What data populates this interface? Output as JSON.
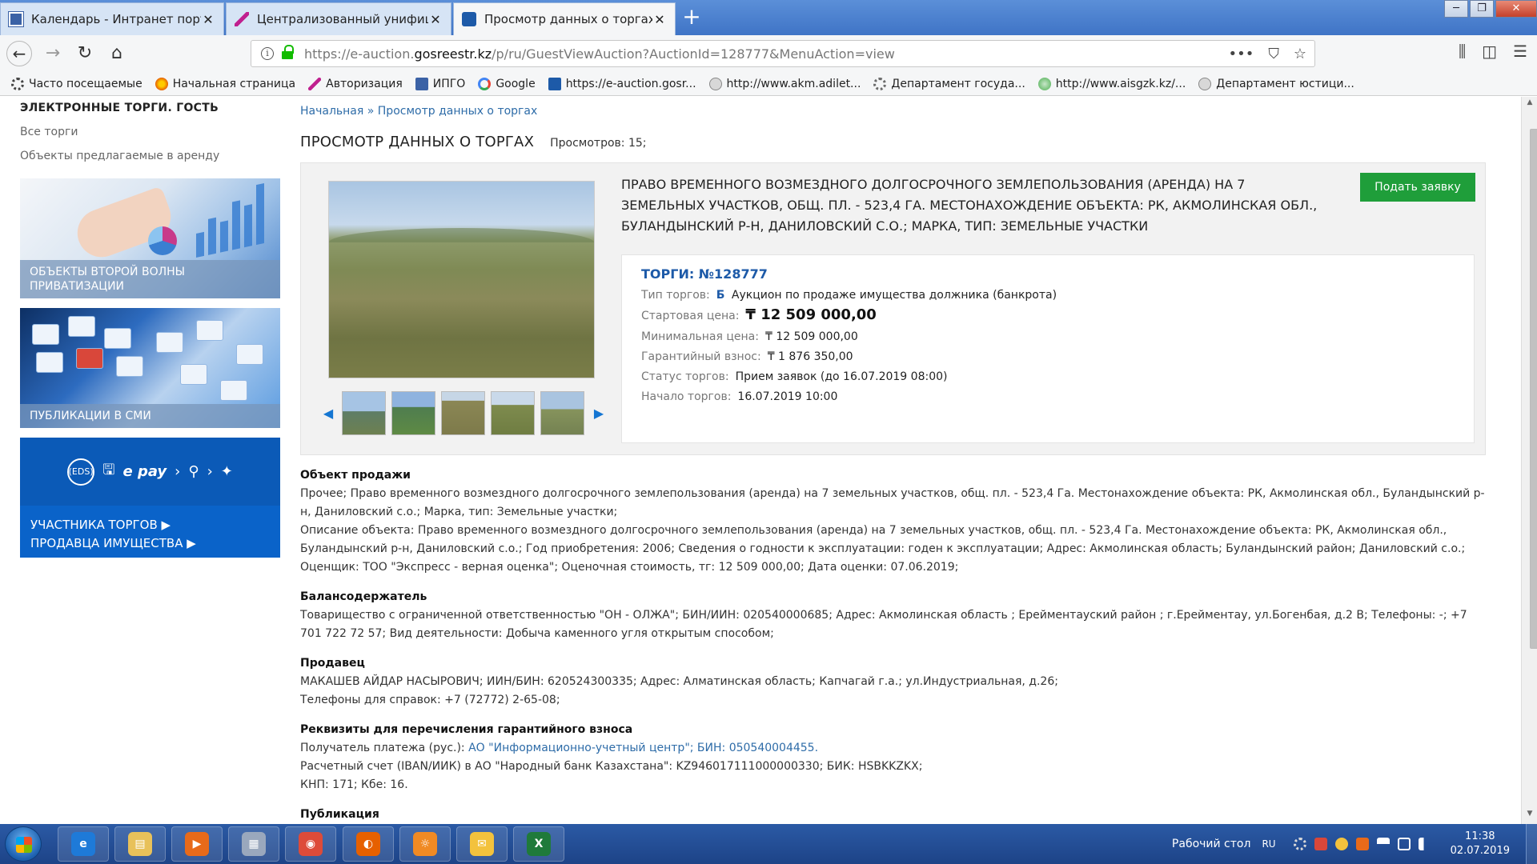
{
  "browser": {
    "tabs": [
      {
        "title": "Календарь - Интранет портал",
        "active": false,
        "color": "#3b62a6"
      },
      {
        "title": "Централизованный унифицированный",
        "active": false,
        "color": "#c0208f"
      },
      {
        "title": "Просмотр данных о торгах",
        "active": true,
        "color": "#1d5aa8"
      }
    ],
    "url_prefix": "https://e-auction.",
    "url_domain": "gosreestr.kz",
    "url_suffix": "/p/ru/GuestViewAuction?AuctionId=128777&MenuAction=view",
    "bookmarks": [
      {
        "label": "Часто посещаемые",
        "color": "#555555"
      },
      {
        "label": "Начальная страница",
        "color": "#e66000"
      },
      {
        "label": "Авторизация",
        "color": "#c0208f"
      },
      {
        "label": "ИПГО",
        "color": "#3b62a6"
      },
      {
        "label": "Google",
        "color": "#4285f4"
      },
      {
        "label": "https://e-auction.gosr...",
        "color": "#1d5aa8"
      },
      {
        "label": "http://www.akm.adilet...",
        "color": "#8a8a8a"
      },
      {
        "label": "Департамент госуда...",
        "color": "#6b6b6b"
      },
      {
        "label": "http://www.aisgzk.kz/...",
        "color": "#4caf50"
      },
      {
        "label": "Департамент юстици...",
        "color": "#8a8a8a"
      }
    ]
  },
  "sidebar": {
    "title": "ЭЛЕКТРОННЫЕ ТОРГИ. ГОСТЬ",
    "links": [
      "Все торги",
      "Объекты предлагаемые в аренду"
    ],
    "banner1_caption": "ОБЪЕКТЫ ВТОРОЙ ВОЛНЫ ПРИВАТИЗАЦИИ",
    "banner2_caption": "ПУБЛИКАЦИИ В СМИ",
    "banner3": {
      "eds": "(EDS)",
      "epay": "e pay",
      "link1": "УЧАСТНИКА ТОРГОВ ▶",
      "link2": "ПРОДАВЦА ИМУЩЕСТВА ▶"
    }
  },
  "breadcrumb": "Начальная » Просмотр данных о торгах",
  "heading": {
    "title": "ПРОСМОТР ДАННЫХ О ТОРГАХ",
    "views": "Просмотров: 15;"
  },
  "lot": {
    "title": "ПРАВО ВРЕМЕННОГО ВОЗМЕЗДНОГО ДОЛГОСРОЧНОГО ЗЕМЛЕПОЛЬЗОВАНИЯ (АРЕНДА) НА 7 ЗЕМЕЛЬНЫХ УЧАСТКОВ, ОБЩ. ПЛ. - 523,4 ГА. МЕСТОНАХОЖДЕНИЕ ОБЪЕКТА: РК, АКМОЛИНСКАЯ ОБЛ., БУЛАНДЫНСКИЙ Р-Н, ДАНИЛОВСКИЙ С.О.; МАРКА, ТИП: ЗЕМЕЛЬНЫЕ УЧАСТКИ",
    "apply_label": "Подать заявку",
    "auction_no": "ТОРГИ: №128777",
    "rows": {
      "type_label": "Тип торгов:",
      "type_code": "Б",
      "type_value": "Аукцион по продаже имущества должника (банкрота)",
      "start_price_label": "Стартовая цена:",
      "start_price_value": "₸ 12 509 000,00",
      "min_price_label": "Минимальная цена:",
      "min_price_value": "₸ 12 509 000,00",
      "deposit_label": "Гарантийный взнос:",
      "deposit_value": "₸ 1 876 350,00",
      "status_label": "Статус торгов:",
      "status_value": "Прием заявок (до 16.07.2019 08:00)",
      "start_label": "Начало торгов:",
      "start_value": "16.07.2019 10:00"
    }
  },
  "sections": {
    "object_title": "Объект продажи",
    "object_text1": "Прочее; Право временного возмездного долгосрочного землепользования (аренда) на 7 земельных участков, общ. пл. - 523,4 Га. Местонахождение объекта: РК, Акмолинская обл., Буландынский р-н, Даниловский с.о.; Марка, тип: Земельные участки;",
    "object_text2": "Описание объекта: Право временного возмездного долгосрочного землепользования (аренда) на 7 земельных участков, общ. пл. - 523,4 Га. Местонахождение объекта: РК, Акмолинская обл., Буландынский р-н, Даниловский с.о.; Год приобретения: 2006; Сведения о годности к эксплуатации: годен к эксплуатации; Адрес: Акмолинская область; Буландынский район; Даниловский с.о.; Оценщик: ТОО \"Экспресс - верная оценка\"; Оценочная стоимость, тг: 12 509 000,00; Дата оценки: 07.06.2019;",
    "holder_title": "Балансодержатель",
    "holder_text": "Товарищество с ограниченной ответственностью \"ОН - ОЛЖА\"; БИН/ИИН: 020540000685; Адрес: Акмолинская область ; Ерейментауский район ; г.Ерейментау, ул.Богенбая, д.2 В; Телефоны: -; +7 701 722 72 57; Вид деятельности: Добыча каменного угля открытым способом;",
    "seller_title": "Продавец",
    "seller_text1": "МАКАШЕВ АЙДАР НАСЫРОВИЧ; ИИН/БИН: 620524300335;  Адрес: Алматинская область; Капчагай г.а.; ул.Индустриальная, д.26;",
    "seller_text2": "Телефоны для справок: +7 (72772) 2-65-08;",
    "req_title": "Реквизиты для перечисления гарантийного взноса",
    "req_recipient_label": "Получатель платежа (рус.): ",
    "req_recipient_value": "АО \"Информационно-учетный центр\"; БИН: 050540004455.",
    "req_account": "Расчетный счет (IBAN/ИИК) в АО \"Народный банк Казахстана\": KZ946017111000000330; БИК: HSBKKZKX;",
    "req_kbe": "КНП: 171; Кбе: 16.",
    "pub_title": "Публикация"
  },
  "taskbar": {
    "apps": [
      {
        "name": "ie",
        "color": "#1e7ad8",
        "glyph": "e"
      },
      {
        "name": "explorer",
        "color": "#e8c15a",
        "glyph": "▤"
      },
      {
        "name": "media-player",
        "color": "#e86a1a",
        "glyph": "▶"
      },
      {
        "name": "calculator",
        "color": "#9aa8bd",
        "glyph": "▦"
      },
      {
        "name": "chrome",
        "color": "#dd4b39",
        "glyph": "◉"
      },
      {
        "name": "firefox",
        "color": "#e66000",
        "glyph": "◐"
      },
      {
        "name": "app-orange",
        "color": "#f08a24",
        "glyph": "☼"
      },
      {
        "name": "mail",
        "color": "#f3c23d",
        "glyph": "✉"
      },
      {
        "name": "excel",
        "color": "#1f7a3a",
        "glyph": "X"
      }
    ],
    "desktop_label": "Рабочий стол",
    "lang": "RU",
    "time": "11:38",
    "date": "02.07.2019"
  }
}
